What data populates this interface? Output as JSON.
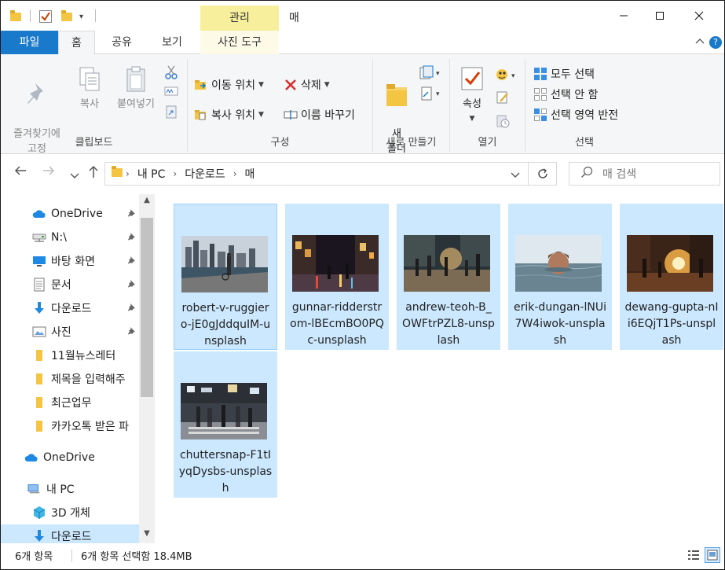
{
  "window": {
    "title": "매",
    "context_tab_group": "관리",
    "minimize": "—",
    "maximize": "☐",
    "close": "✕"
  },
  "tabs": {
    "file": "파일",
    "home": "홈",
    "share": "공유",
    "view": "보기",
    "picture_tools": "사진 도구",
    "collapse": "^",
    "help": "?"
  },
  "ribbon": {
    "clipboard": {
      "label": "클립보드",
      "pin_quick_access": "즐겨찾기에\n고정",
      "copy": "복사",
      "paste": "붙여넣기"
    },
    "organize": {
      "label": "구성",
      "move_to": "이동 위치",
      "copy_to": "복사 위치",
      "delete": "삭제",
      "rename": "이름 바꾸기"
    },
    "new": {
      "label": "새로 만들기",
      "new_folder": "새\n폴더"
    },
    "open": {
      "label": "열기",
      "properties": "속성"
    },
    "select": {
      "label": "선택",
      "select_all": "모두 선택",
      "select_none": "선택 안 함",
      "invert_selection": "선택 영역 반전"
    }
  },
  "address": {
    "crumbs": [
      "내 PC",
      "다운로드",
      "매"
    ],
    "search_placeholder": "매 검색"
  },
  "nav": {
    "items": [
      {
        "label": "OneDrive",
        "icon": "cloud-icon",
        "pinned": true
      },
      {
        "label": "N:\\",
        "icon": "network-drive-icon",
        "pinned": true
      },
      {
        "label": "바탕 화면",
        "icon": "desktop-icon",
        "pinned": true
      },
      {
        "label": "문서",
        "icon": "document-icon",
        "pinned": true
      },
      {
        "label": "다운로드",
        "icon": "download-icon",
        "pinned": true
      },
      {
        "label": "사진",
        "icon": "pictures-icon",
        "pinned": true
      },
      {
        "label": "11월뉴스레터",
        "icon": "folder-icon",
        "pinned": false
      },
      {
        "label": "제목을 입력해주",
        "icon": "folder-icon",
        "pinned": false
      },
      {
        "label": "최근업무",
        "icon": "folder-icon",
        "pinned": false
      },
      {
        "label": "카카오톡 받은 파",
        "icon": "folder-icon",
        "pinned": false
      },
      {
        "label": "OneDrive",
        "icon": "cloud-icon",
        "pinned": false
      },
      {
        "label": "내 PC",
        "icon": "pc-icon",
        "pinned": false
      },
      {
        "label": "3D 개체",
        "icon": "cube-icon",
        "pinned": false
      },
      {
        "label": "다운로드",
        "icon": "download-icon",
        "pinned": false
      }
    ]
  },
  "files": [
    {
      "name": "robert-v-ruggiero-jE0gJddquIM-unsplash"
    },
    {
      "name": "gunnar-ridderstrom-lBEcmBO0PQc-unsplash"
    },
    {
      "name": "andrew-teoh-B_OWFtrPZL8-unsplash"
    },
    {
      "name": "erik-dungan-lNUi7W4iwok-unsplash"
    },
    {
      "name": "dewang-gupta-nIi6EQjT1Ps-unsplash"
    },
    {
      "name": "chuttersnap-F1tIyqDysbs-unsplash"
    }
  ],
  "status": {
    "count": "6개 항목",
    "selected": "6개 항목 선택함 18.4MB"
  },
  "colors": {
    "accent": "#1979ca",
    "selection": "#cce8ff",
    "context_tab": "#f7ef9c"
  }
}
